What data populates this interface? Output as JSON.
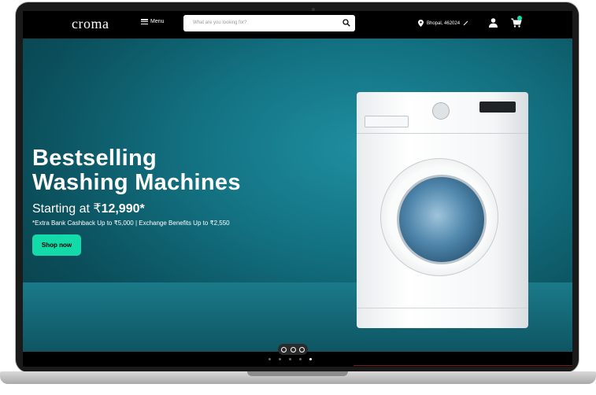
{
  "header": {
    "logo": "croma",
    "menu_label": "Menu",
    "search_placeholder": "What are you looking for?",
    "location": "Bhopal, 462024"
  },
  "hero": {
    "title_line1": "Bestselling",
    "title_line2": "Washing Machines",
    "starting_prefix": "Starting at ₹",
    "starting_price": "12,990*",
    "note": "*Extra Bank Cashback Up to ₹5,000 | Exchange Benefits Up to ₹2,550",
    "cta": "Shop now"
  },
  "carousel": {
    "slides": 5,
    "active_index": 4
  },
  "colors": {
    "accent": "#12daa8",
    "hero_bg": "#137282",
    "header_bg": "#000000"
  },
  "icons": [
    "hamburger-icon",
    "search-icon",
    "location-pin-icon",
    "edit-pencil-icon",
    "user-icon",
    "cart-icon"
  ]
}
